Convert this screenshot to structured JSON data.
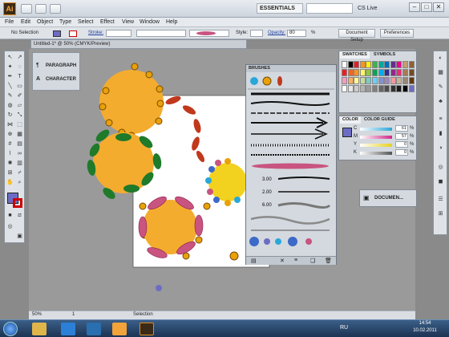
{
  "app": {
    "logo": "Ai",
    "workspace": "ESSENTIALS",
    "cs_live": "CS Live"
  },
  "window_controls": [
    "–",
    "□",
    "✕"
  ],
  "menu": [
    "File",
    "Edit",
    "Object",
    "Type",
    "Select",
    "Effect",
    "View",
    "Window",
    "Help"
  ],
  "control_bar": {
    "selection": "No Selection",
    "stroke_label": "Stroke:",
    "style_label": "Style:",
    "opacity_label": "Opacity:",
    "opacity_value": "80",
    "opacity_unit": "%",
    "doc_setup": "Document Setup",
    "preferences": "Preferences"
  },
  "document_tab": "Untitled-1* @ 50% (CMYK/Preview)",
  "paragraph_panel": [
    "PARAGRAPH",
    "CHARACTER"
  ],
  "swatches_panel": {
    "tabs": [
      "SWATCHES",
      "SYMBOLS"
    ]
  },
  "color_panel": {
    "tabs": [
      "COLOR",
      "COLOR GUIDE"
    ],
    "channels": [
      {
        "label": "C",
        "value": "61",
        "unit": "%",
        "bar_color": "#2aa7d9"
      },
      {
        "label": "M",
        "value": "57",
        "unit": "%",
        "bar_color": "#d02a86"
      },
      {
        "label": "Y",
        "value": "0",
        "unit": "%",
        "bar_color": "#e6d21c"
      },
      {
        "label": "K",
        "value": "0",
        "unit": "%",
        "bar_color": "#555555"
      }
    ]
  },
  "brushes_panel": {
    "title": "BRUSHES",
    "sizes": [
      "3.00",
      "2.00",
      "6.00"
    ]
  },
  "doc_box_label": "DOCUMEN...",
  "status": {
    "zoom": "50%",
    "page": "1",
    "mode": "Selection"
  },
  "taskbar": {
    "lang": "RU",
    "time": "14:54",
    "date": "10.02.2011"
  },
  "colors": {
    "accent_fill": "#6c6cc4",
    "flower_orange": "#f4ac2e",
    "leaf_green": "#1f7a2a",
    "petal_red": "#c0391d",
    "petal_pink": "#c8547f"
  }
}
